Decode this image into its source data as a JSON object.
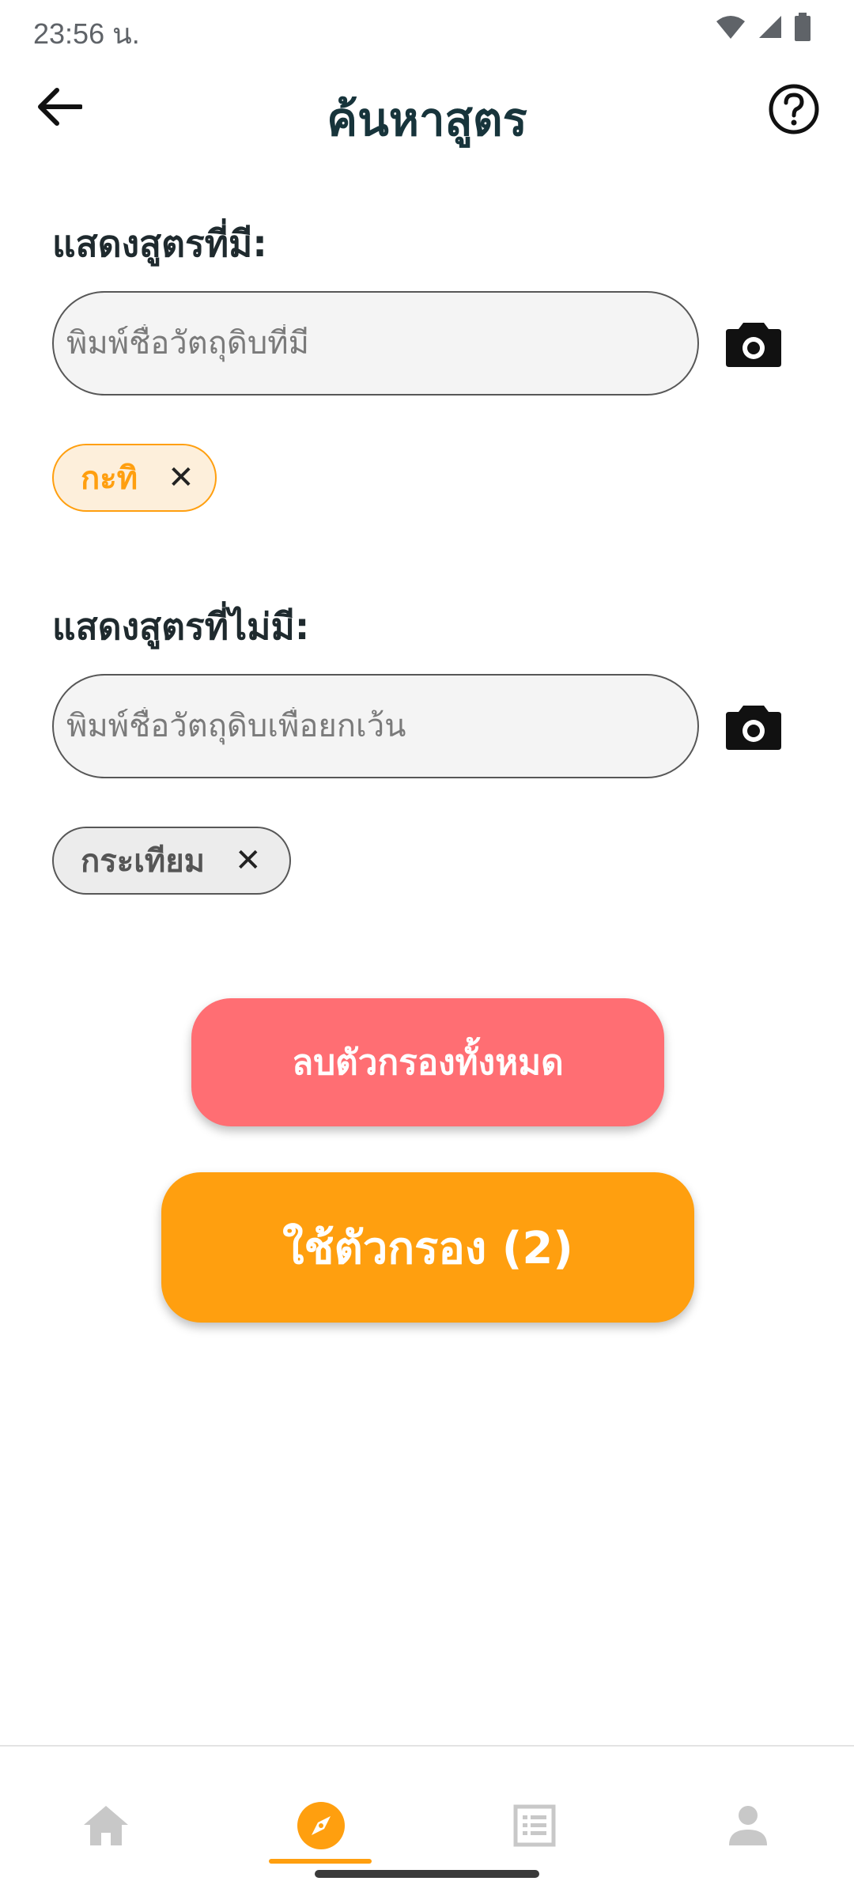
{
  "status_bar": {
    "time": "23:56 น."
  },
  "header": {
    "title": "ค้นหาสูตร"
  },
  "include": {
    "label": "แสดงสูตรที่มี:",
    "placeholder": "พิมพ์ชื่อวัตถุดิบที่มี",
    "chips": [
      {
        "label": "กะทิ"
      }
    ]
  },
  "exclude": {
    "label": "แสดงสูตรที่ไม่มี:",
    "placeholder": "พิมพ์ชื่อวัตถุดิบเพื่อยกเว้น",
    "chips": [
      {
        "label": "กระเทียม"
      }
    ]
  },
  "actions": {
    "clear_label": "ลบตัวกรองทั้งหมด",
    "apply_label": "ใช้ตัวกรอง (2)"
  },
  "icons": {
    "back": "arrow-left-icon",
    "help": "help-circle-icon",
    "camera": "camera-icon",
    "chip_remove": "close-icon",
    "nav": [
      "home-icon",
      "compass-icon",
      "list-icon",
      "person-icon"
    ]
  },
  "colors": {
    "accent": "#ff9f0f",
    "clear": "#ff6e73",
    "title": "#17343b",
    "nav_inactive": "#c8c8c8"
  },
  "bottom_nav": {
    "active_index": 1
  }
}
